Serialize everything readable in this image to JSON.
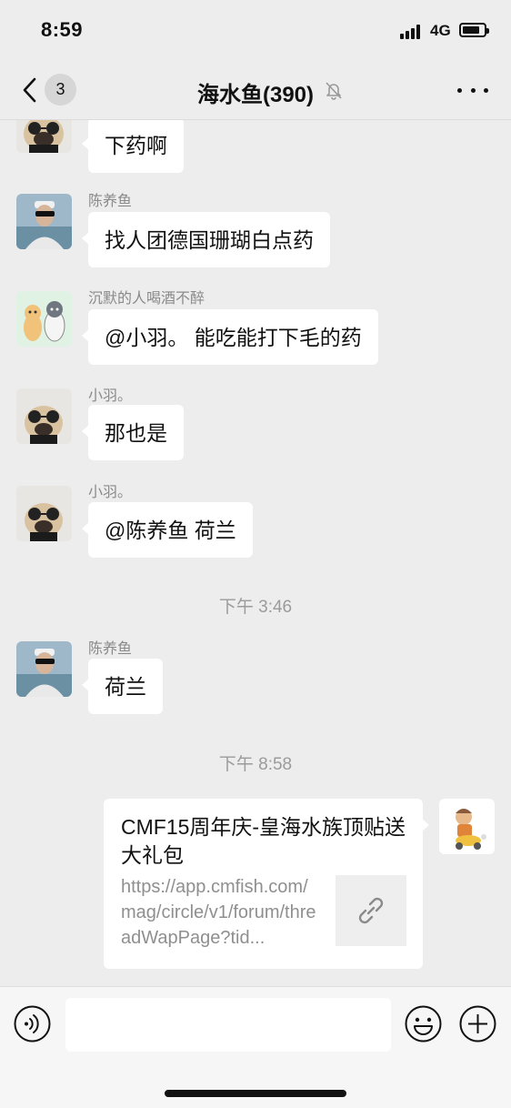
{
  "status_bar": {
    "time": "8:59",
    "network": "4G"
  },
  "nav": {
    "back_count": "3",
    "title": "海水鱼(390)",
    "muted_icon": "bell-slash-icon",
    "more_icon": "ellipsis-icon"
  },
  "messages": [
    {
      "sender": "",
      "text": "下药啊",
      "avatar": "pug-sunglasses"
    },
    {
      "sender": "陈养鱼",
      "text": "找人团德国珊瑚白点药",
      "avatar": "man-sunglasses-beach"
    },
    {
      "sender": "沉默的人喝酒不醉",
      "text": "@小羽。 能吃能打下毛的药",
      "avatar": "cartoon-dog-cat"
    },
    {
      "sender": "小羽。",
      "text": "那也是",
      "avatar": "pug-sunglasses"
    },
    {
      "sender": "小羽。",
      "text": "@陈养鱼 荷兰",
      "avatar": "pug-sunglasses"
    },
    {
      "sender": "陈养鱼",
      "text": "荷兰",
      "avatar": "man-sunglasses-beach"
    }
  ],
  "time_separators": [
    "下午 3:46",
    "下午 8:58"
  ],
  "link_card": {
    "title": "CMF15周年庆-皇海水族顶贴送大礼包",
    "description": "https://app.cmfish.com/mag/circle/v1/forum/threadWapPage?tid...",
    "thumb_icon": "link-icon",
    "avatar": "cartoon-scooter"
  },
  "input_bar": {
    "voice_icon": "voice-icon",
    "emoji_icon": "smile-icon",
    "plus_icon": "plus-circle-icon",
    "input_value": ""
  },
  "colors": {
    "background": "#ededed",
    "bubble": "#ffffff",
    "meta_text": "#8a8a8a"
  }
}
